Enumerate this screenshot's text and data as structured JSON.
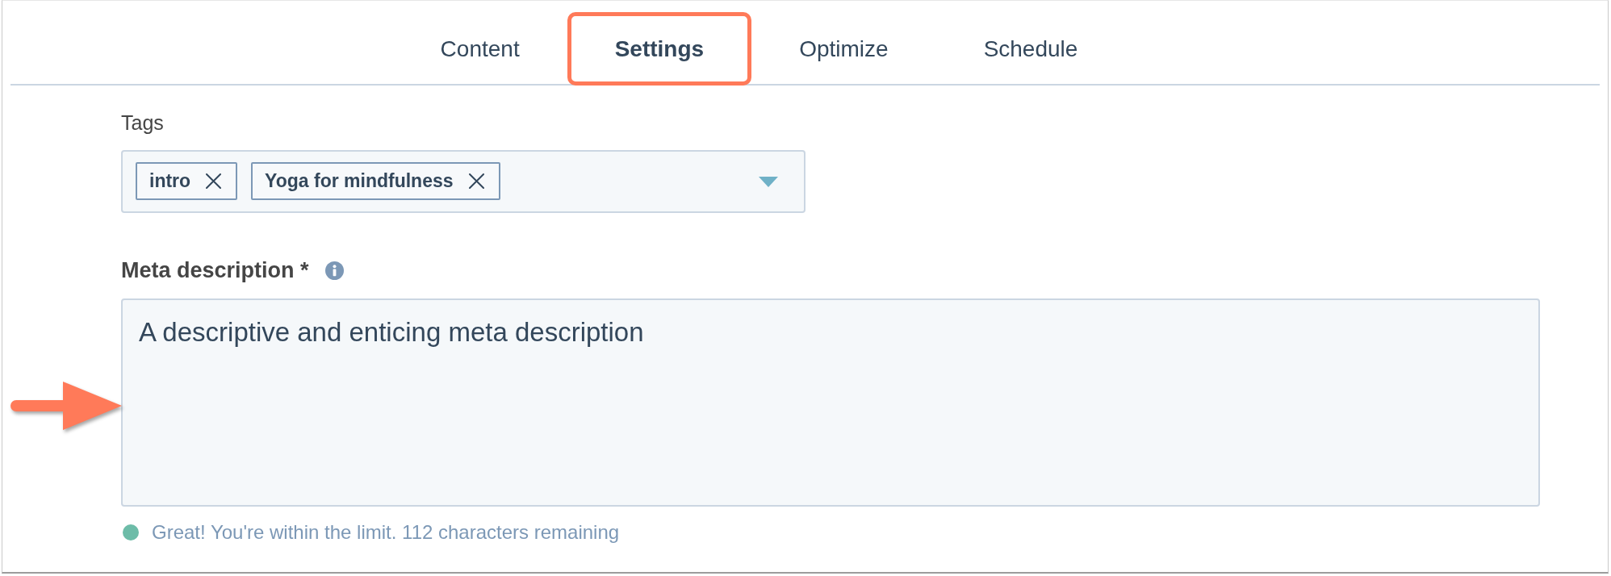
{
  "tabs": [
    {
      "label": "Content",
      "selected": false,
      "highlighted": false
    },
    {
      "label": "Settings",
      "selected": true,
      "highlighted": true
    },
    {
      "label": "Optimize",
      "selected": false,
      "highlighted": false
    },
    {
      "label": "Schedule",
      "selected": false,
      "highlighted": false
    }
  ],
  "tags": {
    "label": "Tags",
    "items": [
      {
        "text": "intro"
      },
      {
        "text": "Yoga for mindfulness"
      }
    ]
  },
  "meta_description": {
    "label": "Meta description *",
    "value": "A descriptive and enticing meta description",
    "within_limit": true,
    "message": "Great! You're within the limit. 112 characters remaining"
  }
}
